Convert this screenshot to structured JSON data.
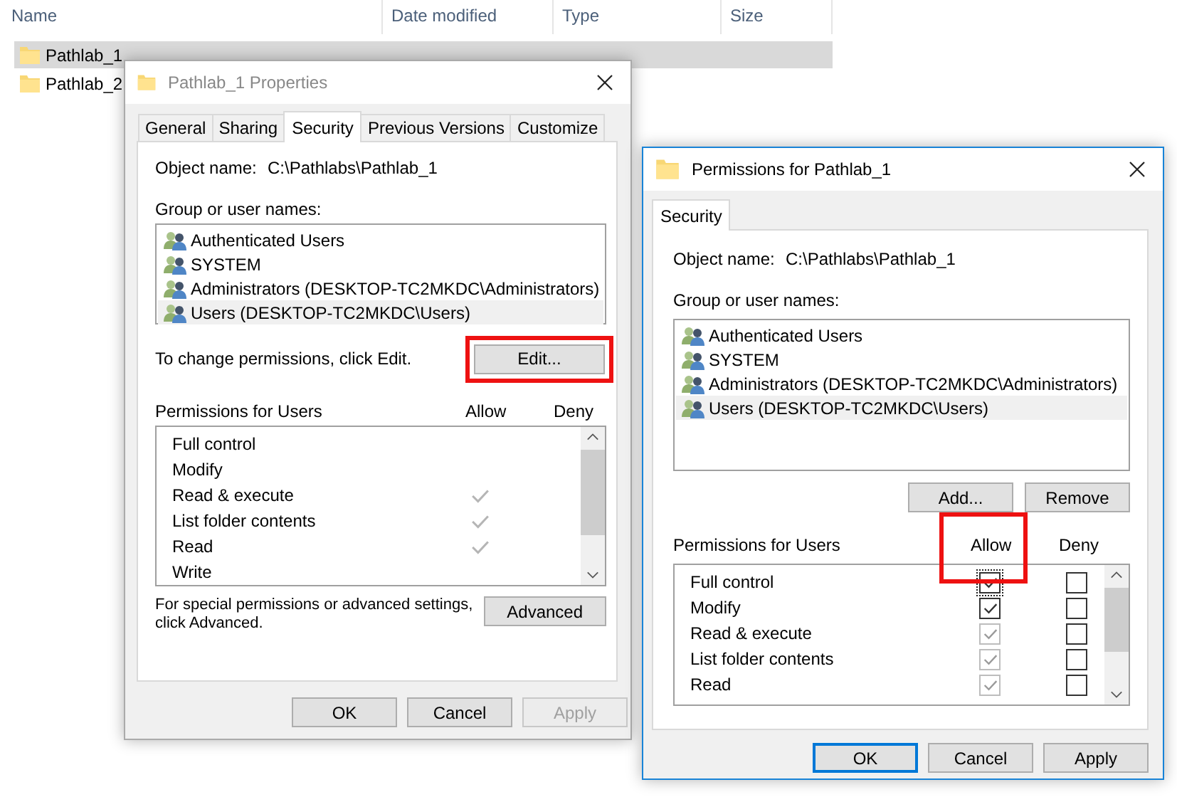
{
  "explorer": {
    "columns": [
      "Name",
      "Date modified",
      "Type",
      "Size"
    ],
    "rows": [
      {
        "name": "Pathlab_1",
        "selected": true
      },
      {
        "name": "Pathlab_2",
        "selected": false
      }
    ]
  },
  "properties_dialog": {
    "title": "Pathlab_1 Properties",
    "tabs": [
      {
        "label": "General",
        "selected": false
      },
      {
        "label": "Sharing",
        "selected": false
      },
      {
        "label": "Security",
        "selected": true
      },
      {
        "label": "Previous Versions",
        "selected": false
      },
      {
        "label": "Customize",
        "selected": false
      }
    ],
    "object_label": "Object name:",
    "object_value": "C:\\Pathlabs\\Pathlab_1",
    "groups_label": "Group or user names:",
    "groups": [
      {
        "name": "Authenticated Users",
        "selected": false
      },
      {
        "name": "SYSTEM",
        "selected": false
      },
      {
        "name": "Administrators (DESKTOP-TC2MKDC\\Administrators)",
        "selected": false
      },
      {
        "name": "Users (DESKTOP-TC2MKDC\\Users)",
        "selected": true
      }
    ],
    "edit_hint": "To change permissions, click Edit.",
    "edit_button": {
      "label": "Edit...",
      "highlighted": true
    },
    "permissions_label": "Permissions for Users",
    "allow_header": "Allow",
    "deny_header": "Deny",
    "permissions": [
      {
        "name": "Full control",
        "allow": false
      },
      {
        "name": "Modify",
        "allow": false
      },
      {
        "name": "Read & execute",
        "allow": true
      },
      {
        "name": "List folder contents",
        "allow": true
      },
      {
        "name": "Read",
        "allow": true
      },
      {
        "name": "Write",
        "allow": false
      }
    ],
    "advanced_hint": "For special permissions or advanced settings, click Advanced.",
    "advanced_button": "Advanced",
    "buttons": [
      {
        "label": "OK",
        "default": false,
        "disabled": false
      },
      {
        "label": "Cancel",
        "default": false,
        "disabled": false
      },
      {
        "label": "Apply",
        "default": false,
        "disabled": true
      }
    ]
  },
  "permissions_dialog": {
    "title": "Permissions for Pathlab_1",
    "tabs": [
      {
        "label": "Security",
        "selected": true
      }
    ],
    "object_label": "Object name:",
    "object_value": "C:\\Pathlabs\\Pathlab_1",
    "groups_label": "Group or user names:",
    "groups": [
      {
        "name": "Authenticated Users",
        "selected": false
      },
      {
        "name": "SYSTEM",
        "selected": false
      },
      {
        "name": "Administrators (DESKTOP-TC2MKDC\\Administrators)",
        "selected": false
      },
      {
        "name": "Users (DESKTOP-TC2MKDC\\Users)",
        "selected": true
      }
    ],
    "group_buttons": [
      "Add...",
      "Remove"
    ],
    "permissions_label": "Permissions for Users",
    "allow_header": {
      "label": "Allow",
      "highlighted": true
    },
    "deny_header": "Deny",
    "permissions": [
      {
        "name": "Full control",
        "allow": true,
        "allow_disabled": false,
        "deny": false,
        "focused": true
      },
      {
        "name": "Modify",
        "allow": true,
        "allow_disabled": false,
        "deny": false,
        "focused": false
      },
      {
        "name": "Read & execute",
        "allow": true,
        "allow_disabled": true,
        "deny": false,
        "focused": false
      },
      {
        "name": "List folder contents",
        "allow": true,
        "allow_disabled": true,
        "deny": false,
        "focused": false
      },
      {
        "name": "Read",
        "allow": true,
        "allow_disabled": true,
        "deny": false,
        "focused": false
      }
    ],
    "buttons": [
      {
        "label": "OK",
        "default": true,
        "disabled": false
      },
      {
        "label": "Cancel",
        "default": false,
        "disabled": false
      },
      {
        "label": "Apply",
        "default": false,
        "disabled": false
      }
    ]
  }
}
